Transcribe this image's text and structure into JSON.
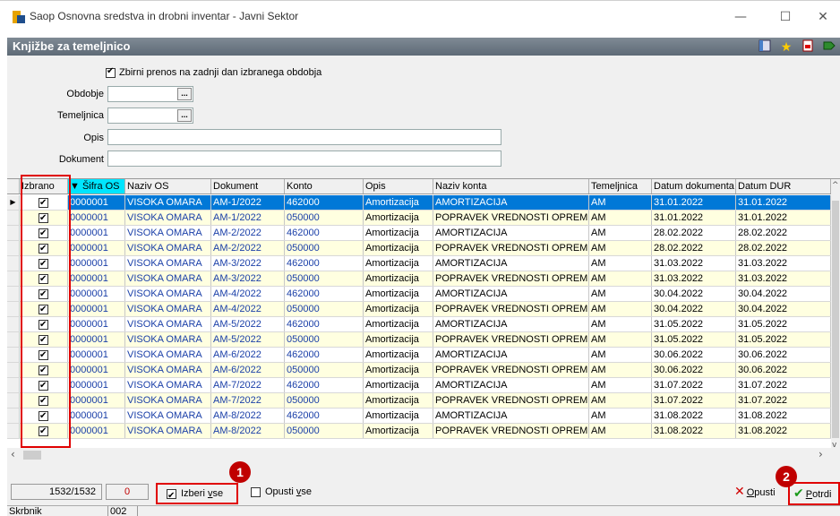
{
  "window": {
    "title": "Saop Osnovna sredstva in drobni inventar - Javni Sektor",
    "minimize": "—",
    "maximize": "☐",
    "close": "✕"
  },
  "form": {
    "title": "Knjižbe za temeljnico",
    "tools": [
      "layout-icon",
      "star-icon",
      "pdf-icon",
      "export-icon"
    ]
  },
  "filters": {
    "zbirni_label": "Zbirni prenos na zadnji dan izbranega obdobja",
    "zbirni_checked": true,
    "obdobje_label": "Obdobje",
    "obdobje_value": "",
    "temeljnica_label": "Temeljnica",
    "temeljnica_value": "",
    "opis_label": "Opis",
    "opis_value": "",
    "dokument_label": "Dokument",
    "dokument_value": "",
    "dots": "..."
  },
  "grid": {
    "columns": [
      "Izbrano",
      "▼ Šifra OS",
      "Naziv OS",
      "Dokument",
      "Konto",
      "Opis",
      "Naziv konta",
      "Temeljnica",
      "Datum dokumenta",
      "Datum DUR"
    ],
    "rows": [
      [
        "0000001",
        "VISOKA OMARA",
        "AM-1/2022",
        "462000",
        "Amortizacija",
        "AMORTIZACIJA",
        "AM",
        "31.01.2022",
        "31.01.2022"
      ],
      [
        "0000001",
        "VISOKA OMARA",
        "AM-1/2022",
        "050000",
        "Amortizacija",
        "POPRAVEK VREDNOSTI OPREME",
        "AM",
        "31.01.2022",
        "31.01.2022"
      ],
      [
        "0000001",
        "VISOKA OMARA",
        "AM-2/2022",
        "462000",
        "Amortizacija",
        "AMORTIZACIJA",
        "AM",
        "28.02.2022",
        "28.02.2022"
      ],
      [
        "0000001",
        "VISOKA OMARA",
        "AM-2/2022",
        "050000",
        "Amortizacija",
        "POPRAVEK VREDNOSTI OPREME",
        "AM",
        "28.02.2022",
        "28.02.2022"
      ],
      [
        "0000001",
        "VISOKA OMARA",
        "AM-3/2022",
        "462000",
        "Amortizacija",
        "AMORTIZACIJA",
        "AM",
        "31.03.2022",
        "31.03.2022"
      ],
      [
        "0000001",
        "VISOKA OMARA",
        "AM-3/2022",
        "050000",
        "Amortizacija",
        "POPRAVEK VREDNOSTI OPREME",
        "AM",
        "31.03.2022",
        "31.03.2022"
      ],
      [
        "0000001",
        "VISOKA OMARA",
        "AM-4/2022",
        "462000",
        "Amortizacija",
        "AMORTIZACIJA",
        "AM",
        "30.04.2022",
        "30.04.2022"
      ],
      [
        "0000001",
        "VISOKA OMARA",
        "AM-4/2022",
        "050000",
        "Amortizacija",
        "POPRAVEK VREDNOSTI OPREME",
        "AM",
        "30.04.2022",
        "30.04.2022"
      ],
      [
        "0000001",
        "VISOKA OMARA",
        "AM-5/2022",
        "462000",
        "Amortizacija",
        "AMORTIZACIJA",
        "AM",
        "31.05.2022",
        "31.05.2022"
      ],
      [
        "0000001",
        "VISOKA OMARA",
        "AM-5/2022",
        "050000",
        "Amortizacija",
        "POPRAVEK VREDNOSTI OPREME",
        "AM",
        "31.05.2022",
        "31.05.2022"
      ],
      [
        "0000001",
        "VISOKA OMARA",
        "AM-6/2022",
        "462000",
        "Amortizacija",
        "AMORTIZACIJA",
        "AM",
        "30.06.2022",
        "30.06.2022"
      ],
      [
        "0000001",
        "VISOKA OMARA",
        "AM-6/2022",
        "050000",
        "Amortizacija",
        "POPRAVEK VREDNOSTI OPREME",
        "AM",
        "30.06.2022",
        "30.06.2022"
      ],
      [
        "0000001",
        "VISOKA OMARA",
        "AM-7/2022",
        "462000",
        "Amortizacija",
        "AMORTIZACIJA",
        "AM",
        "31.07.2022",
        "31.07.2022"
      ],
      [
        "0000001",
        "VISOKA OMARA",
        "AM-7/2022",
        "050000",
        "Amortizacija",
        "POPRAVEK VREDNOSTI OPREME",
        "AM",
        "31.07.2022",
        "31.07.2022"
      ],
      [
        "0000001",
        "VISOKA OMARA",
        "AM-8/2022",
        "462000",
        "Amortizacija",
        "AMORTIZACIJA",
        "AM",
        "31.08.2022",
        "31.08.2022"
      ],
      [
        "0000001",
        "VISOKA OMARA",
        "AM-8/2022",
        "050000",
        "Amortizacija",
        "POPRAVEK VREDNOSTI OPREME",
        "AM",
        "31.08.2022",
        "31.08.2022"
      ]
    ]
  },
  "footer": {
    "count": "1532/1532",
    "count2": "0",
    "izberi_vse": "Izberi vse",
    "izberi_checked": true,
    "opusti_vse": "Opusti vse",
    "badge1": "1",
    "badge2": "2",
    "opusti": "Opusti",
    "potrdi": "Potrdi",
    "skrbnik": "Skrbnik",
    "skrbnik_value": "002"
  },
  "colors": {
    "selected_row": "#0078d7",
    "alt_row": "#ffffe0",
    "sort_header": "#00e5ff",
    "highlight": "#e00000"
  }
}
